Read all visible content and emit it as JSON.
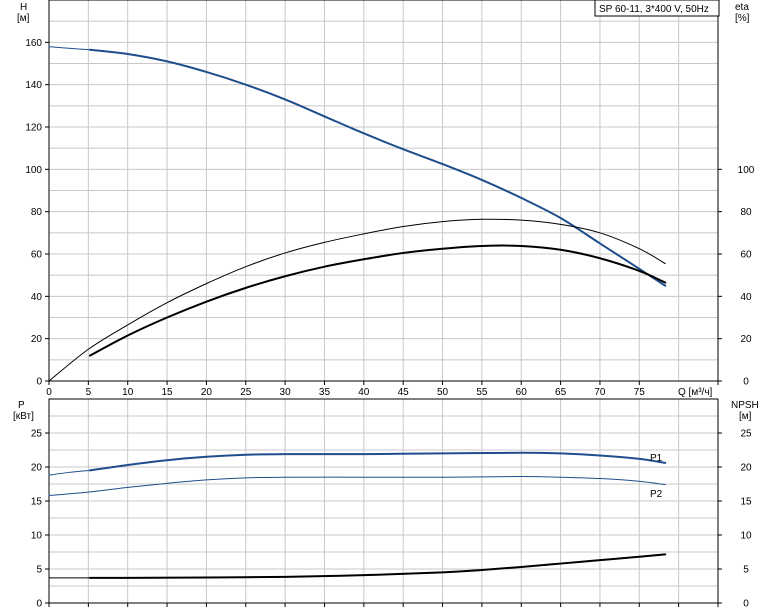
{
  "title_box": "SP 60-11, 3*400 V, 50Hz",
  "top": {
    "y_left_label": "H",
    "y_left_unit": "[м]",
    "y_right_label": "eta",
    "y_right_unit": "[%]",
    "x_label": "Q [м³/ч]"
  },
  "bottom": {
    "y_left_label": "P",
    "y_left_unit": "[кВт]",
    "y_right_label": "NPSH",
    "y_right_unit": "[м]"
  },
  "colors": {
    "head": "#1f4e8c",
    "power": "#1f4e8c",
    "efficiency": "#000000",
    "npsh": "#000000",
    "grid": "#c8c8c8"
  },
  "chart_data": [
    {
      "type": "line",
      "panel": "head-efficiency",
      "xlabel": "Q [м³/ч]",
      "xlim": [
        0,
        85
      ],
      "x_ticks": [
        0,
        5,
        10,
        15,
        20,
        25,
        30,
        35,
        40,
        45,
        50,
        55,
        60,
        65,
        70,
        75
      ],
      "left_axis": {
        "label": "H",
        "unit": "[м]",
        "ylim": [
          0,
          180
        ],
        "ticks": [
          0,
          20,
          40,
          60,
          80,
          100,
          120,
          140,
          160
        ]
      },
      "right_axis": {
        "label": "eta",
        "unit": "[%]",
        "ylim": [
          0,
          180
        ],
        "ticks": [
          0,
          20,
          40,
          60,
          80,
          100
        ]
      },
      "series": [
        {
          "axis": "left",
          "role": "head-ext",
          "color": "#1f4e8c",
          "width": 1,
          "x": [
            0,
            2.5,
            5.2
          ],
          "y": [
            158,
            157.2,
            156.5
          ]
        },
        {
          "axis": "left",
          "role": "head",
          "color": "#1f4e8c",
          "width": 2,
          "x": [
            5.2,
            10,
            15,
            20,
            25,
            30,
            35,
            40,
            45,
            50,
            55,
            60,
            65,
            70,
            75,
            78.3
          ],
          "y": [
            156.5,
            154.5,
            151,
            146,
            140,
            133,
            125,
            117,
            109.5,
            102.5,
            95,
            86.5,
            77,
            65,
            53,
            45
          ]
        },
        {
          "axis": "right",
          "role": "efficiency-upper",
          "color": "#000000",
          "width": 1,
          "x": [
            0,
            5,
            10,
            15,
            20,
            25,
            30,
            35,
            40,
            45,
            50,
            55,
            60,
            65,
            70,
            75,
            78.3
          ],
          "y": [
            0,
            15,
            26.5,
            37,
            46,
            54,
            60.5,
            65.5,
            69.5,
            73,
            75.3,
            76.4,
            76,
            74,
            70,
            62.5,
            55.5
          ]
        },
        {
          "axis": "right",
          "role": "efficiency",
          "color": "#000000",
          "width": 2,
          "x": [
            5.2,
            10,
            15,
            20,
            25,
            30,
            35,
            40,
            45,
            50,
            55,
            60,
            65,
            70,
            75,
            78.3
          ],
          "y": [
            12,
            21.5,
            30,
            37.5,
            44,
            49.5,
            54,
            57.5,
            60.5,
            62.5,
            63.8,
            63.8,
            62,
            58,
            52,
            46.5
          ]
        }
      ]
    },
    {
      "type": "line",
      "panel": "power-npsh",
      "xlim": [
        0,
        85
      ],
      "left_axis": {
        "label": "P",
        "unit": "[кВт]",
        "ylim": [
          0,
          30
        ],
        "ticks": [
          0,
          5,
          10,
          15,
          20,
          25
        ]
      },
      "right_axis": {
        "label": "NPSH",
        "unit": "[м]",
        "ylim": [
          0,
          30
        ],
        "ticks": [
          0,
          5,
          10,
          15,
          20,
          25
        ]
      },
      "series": [
        {
          "axis": "left",
          "role": "p1-ext",
          "color": "#1f4e8c",
          "width": 1,
          "x": [
            0,
            2.5,
            5.2
          ],
          "y": [
            18.8,
            19.2,
            19.5
          ]
        },
        {
          "name": "P1",
          "axis": "left",
          "role": "p1",
          "color": "#1f4e8c",
          "width": 2,
          "x": [
            5.2,
            10,
            15,
            20,
            25,
            30,
            40,
            50,
            60,
            65,
            70,
            75,
            78.3
          ],
          "y": [
            19.5,
            20.3,
            21.0,
            21.5,
            21.8,
            21.9,
            21.9,
            22.0,
            22.1,
            22.0,
            21.7,
            21.2,
            20.6
          ]
        },
        {
          "name": "P2",
          "axis": "left",
          "role": "p2",
          "color": "#1f4e8c",
          "width": 1,
          "x": [
            0,
            5,
            10,
            15,
            20,
            25,
            30,
            40,
            50,
            60,
            65,
            70,
            75,
            78.3
          ],
          "y": [
            15.8,
            16.3,
            17.0,
            17.6,
            18.1,
            18.4,
            18.5,
            18.5,
            18.5,
            18.6,
            18.5,
            18.3,
            17.9,
            17.4
          ]
        },
        {
          "axis": "right",
          "role": "npsh-ext",
          "color": "#000000",
          "width": 1,
          "x": [
            0,
            2.5,
            5.2
          ],
          "y": [
            3.7,
            3.7,
            3.7
          ]
        },
        {
          "axis": "right",
          "role": "npsh",
          "color": "#000000",
          "width": 2,
          "x": [
            5.2,
            10,
            20,
            30,
            40,
            50,
            55,
            60,
            65,
            70,
            75,
            78.3
          ],
          "y": [
            3.7,
            3.7,
            3.75,
            3.85,
            4.1,
            4.5,
            4.85,
            5.3,
            5.8,
            6.3,
            6.8,
            7.15
          ]
        }
      ]
    }
  ]
}
